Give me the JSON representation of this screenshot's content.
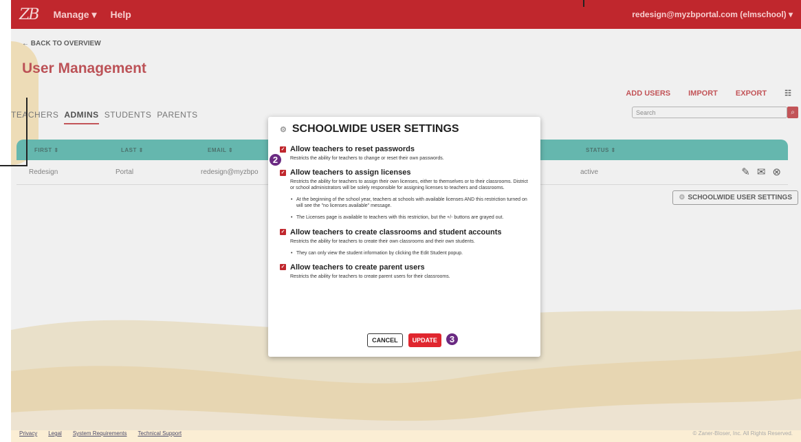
{
  "topbar": {
    "logo": "ZB",
    "nav": [
      "Manage ▾",
      "Help"
    ],
    "user": "redesign@myzbportal.com (elmschool) ▾"
  },
  "page": {
    "back": "← BACK TO OVERVIEW",
    "title": "User Management",
    "actions": [
      "ADD USERS",
      "IMPORT",
      "EXPORT"
    ],
    "tabs": [
      "TEACHERS",
      "ADMINS",
      "STUDENTS",
      "PARENTS"
    ],
    "search_placeholder": "Search",
    "columns": [
      "FIRST ⇕",
      "LAST ⇕",
      "EMAIL ⇕",
      "STATUS ⇕"
    ],
    "row": {
      "first": "Redesign",
      "last": "Portal",
      "email": "redesign@myzbpo",
      "status": "active"
    },
    "settings_button": "SCHOOLWIDE USER SETTINGS"
  },
  "modal": {
    "title": "SCHOOLWIDE USER SETTINGS",
    "options": [
      {
        "label": "Allow teachers to reset passwords",
        "desc": "Restricts the ability for teachers to change or reset their own passwords.",
        "checked": true
      },
      {
        "label": "Allow teachers to assign licenses",
        "desc": "Restricts the ability for teachers to assign their own licenses, either to themselves or to their classrooms. District or school administrators will be solely responsible for assigning licenses to teachers and classrooms.",
        "checked": true
      },
      {
        "label": "Allow teachers to create classrooms and student accounts",
        "desc": "Restricts the ability for teachers to create their own classrooms and their own students.",
        "checked": true
      },
      {
        "label": "Allow teachers to create parent users",
        "desc": "Restricts the ability for teachers to create parent users for their classrooms.",
        "checked": true
      }
    ],
    "license_bullets": [
      "At the beginning of the school year, teachers at schools with available licenses AND this restriction turned on will see the \"no licenses available\" message.",
      "The Licenses page is available to teachers with this restriction, but the +/- buttons are grayed out."
    ],
    "classroom_bullets": [
      "They can only view the student information by clicking the Edit Student popup."
    ],
    "cancel": "CANCEL",
    "update": "UPDATE"
  },
  "steps": [
    "2",
    "3"
  ],
  "footer": {
    "links": [
      "Privacy",
      "Legal",
      "System Requirements",
      "Technical Support"
    ],
    "copyright": "© Zaner-Bloser, Inc. All Rights Reserved."
  },
  "colors": {
    "brand_red": "#c0272d",
    "table_header": "#3fb0a4",
    "step_purple": "#6a2a82"
  }
}
